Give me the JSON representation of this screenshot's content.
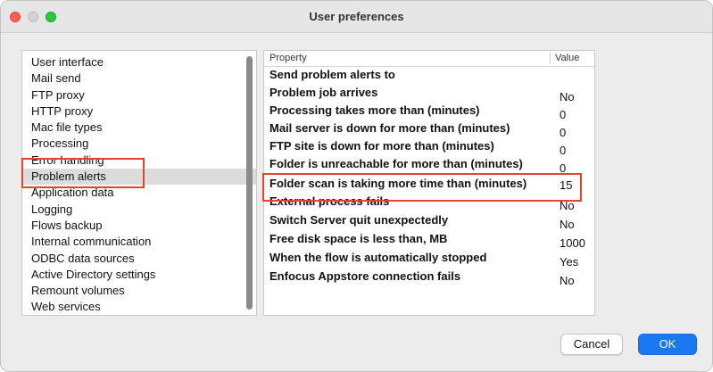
{
  "window": {
    "title": "User preferences"
  },
  "sidebar": {
    "items": [
      {
        "label": "User interface"
      },
      {
        "label": "Mail send"
      },
      {
        "label": "FTP proxy"
      },
      {
        "label": "HTTP proxy"
      },
      {
        "label": "Mac file types"
      },
      {
        "label": "Processing"
      },
      {
        "label": "Error handling"
      },
      {
        "label": "Problem alerts"
      },
      {
        "label": "Application data"
      },
      {
        "label": "Logging"
      },
      {
        "label": "Flows backup"
      },
      {
        "label": "Internal communication"
      },
      {
        "label": "ODBC data sources"
      },
      {
        "label": "Active Directory settings"
      },
      {
        "label": "Remount volumes"
      },
      {
        "label": "Web services"
      }
    ],
    "selected": "Problem alerts"
  },
  "table": {
    "columns": {
      "property": "Property",
      "value": "Value"
    },
    "rows": [
      {
        "property": "Send problem alerts to",
        "value": ""
      },
      {
        "property": "Problem job arrives",
        "value": "No"
      },
      {
        "property": "Processing takes more than (minutes)",
        "value": "0"
      },
      {
        "property": "Mail server is down for more than (minutes)",
        "value": "0"
      },
      {
        "property": "FTP site is down for more than (minutes)",
        "value": "0"
      },
      {
        "property": "Folder is unreachable for more than (minutes)",
        "value": "0"
      },
      {
        "property": "Folder scan is taking more time than (minutes)",
        "value": "15"
      },
      {
        "property": "External process fails",
        "value": "No"
      },
      {
        "property": "Switch Server quit unexpectedly",
        "value": "No"
      },
      {
        "property": "Free disk space is less than, MB",
        "value": "1000"
      },
      {
        "property": "When the flow is automatically stopped",
        "value": "Yes"
      },
      {
        "property": "Enfocus Appstore connection fails",
        "value": "No"
      }
    ]
  },
  "buttons": {
    "cancel": "Cancel",
    "ok": "OK"
  },
  "colors": {
    "accent": "#1a79f0",
    "highlight_box": "#e2442f"
  }
}
